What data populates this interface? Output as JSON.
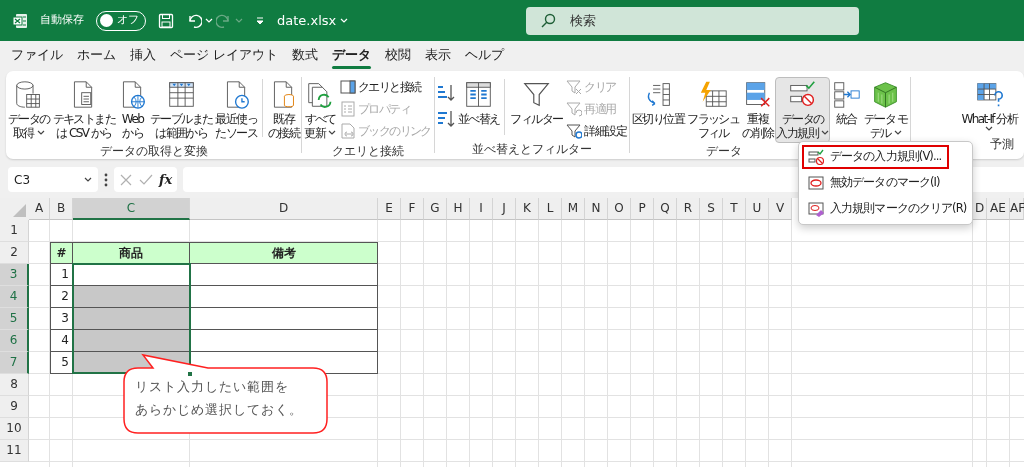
{
  "title_bar": {
    "autosave_label": "自動保存",
    "autosave": {
      "label": "オフ",
      "on": false
    },
    "filename": "date.xlsx",
    "search": {
      "placeholder": "検索"
    }
  },
  "tabs": [
    {
      "label": "ファイル",
      "selected": false
    },
    {
      "label": "ホーム",
      "selected": false
    },
    {
      "label": "挿入",
      "selected": false
    },
    {
      "label": "ページ レイアウト",
      "selected": false
    },
    {
      "label": "数式",
      "selected": false
    },
    {
      "label": "データ",
      "selected": true
    },
    {
      "label": "校閲",
      "selected": false
    },
    {
      "label": "表示",
      "selected": false
    },
    {
      "label": "ヘルプ",
      "selected": false
    }
  ],
  "ribbon_groups": [
    {
      "label": "データの取得と変換",
      "items": [
        {
          "kind": "large",
          "lines": [
            "データの",
            "取得"
          ],
          "dropdown": true,
          "pressed": false
        },
        {
          "kind": "large",
          "lines": [
            "テキストまた",
            "は CSV から"
          ],
          "dropdown": false,
          "pressed": false
        },
        {
          "kind": "large",
          "lines": [
            "Web",
            "から"
          ],
          "dropdown": false,
          "pressed": false
        },
        {
          "kind": "large",
          "lines": [
            "テーブルまた",
            "は範囲から"
          ],
          "dropdown": false,
          "pressed": false
        },
        {
          "kind": "large",
          "lines": [
            "最近使っ",
            "たソース"
          ],
          "dropdown": false,
          "pressed": false
        },
        {
          "kind": "separator"
        },
        {
          "kind": "large",
          "lines": [
            "既存",
            "の接続"
          ],
          "dropdown": false,
          "pressed": false
        }
      ]
    },
    {
      "label": "クエリと接続",
      "items": [
        {
          "kind": "large",
          "lines": [
            "すべて",
            "更新"
          ],
          "dropdown": true,
          "pressed": false
        },
        {
          "kind": "stack",
          "items": [
            {
              "label": "クエリと接続",
              "disabled": false
            },
            {
              "label": "プロパティ",
              "disabled": true
            },
            {
              "label": "ブックのリンク",
              "disabled": true
            }
          ]
        }
      ]
    },
    {
      "label": "並べ替えとフィルター",
      "items": [
        {
          "kind": "sort_pair"
        },
        {
          "kind": "large",
          "lines": [
            "並べ替え"
          ],
          "dropdown": false,
          "pressed": false
        },
        {
          "kind": "separator"
        },
        {
          "kind": "large",
          "lines": [
            "フィルター"
          ],
          "dropdown": false,
          "pressed": false
        },
        {
          "kind": "stack",
          "items": [
            {
              "label": "クリア",
              "disabled": true
            },
            {
              "label": "再適用",
              "disabled": true
            },
            {
              "label": "詳細設定",
              "disabled": false
            }
          ]
        }
      ]
    },
    {
      "label": "データ",
      "items": [
        {
          "kind": "large",
          "lines": [
            "区切り位置"
          ],
          "dropdown": false,
          "pressed": false
        },
        {
          "kind": "large",
          "lines": [
            "フラッシュ",
            "フィル"
          ],
          "dropdown": false,
          "pressed": false
        },
        {
          "kind": "large",
          "lines": [
            "重複",
            "の削除"
          ],
          "dropdown": false,
          "pressed": false
        },
        {
          "kind": "large",
          "lines": [
            "データの",
            "入力規則"
          ],
          "dropdown": true,
          "pressed": true
        },
        {
          "kind": "large",
          "lines": [
            "統合"
          ],
          "dropdown": false,
          "pressed": false
        },
        {
          "kind": "large",
          "lines": [
            "データ モ",
            "デル"
          ],
          "dropdown": true,
          "pressed": false
        }
      ]
    },
    {
      "label": "予測",
      "items": [
        {
          "kind": "large",
          "lines": [
            "What-If 分析"
          ],
          "dropdown": true,
          "pressed": false
        }
      ]
    }
  ],
  "formula_bar": {
    "name_box": "C3",
    "fx": "fx"
  },
  "sheet": {
    "columns": [
      {
        "label": "A",
        "selected": false
      },
      {
        "label": "B",
        "selected": false
      },
      {
        "label": "C",
        "selected": true
      },
      {
        "label": "D",
        "selected": false
      },
      {
        "label": "E",
        "selected": false
      },
      {
        "label": "F",
        "selected": false
      },
      {
        "label": "G",
        "selected": false
      },
      {
        "label": "H",
        "selected": false
      },
      {
        "label": "I",
        "selected": false
      },
      {
        "label": "J",
        "selected": false
      },
      {
        "label": "K",
        "selected": false
      },
      {
        "label": "L",
        "selected": false
      },
      {
        "label": "M",
        "selected": false
      },
      {
        "label": "N",
        "selected": false
      },
      {
        "label": "O",
        "selected": false
      },
      {
        "label": "P",
        "selected": false
      },
      {
        "label": "Q",
        "selected": false
      },
      {
        "label": "R",
        "selected": false
      },
      {
        "label": "S",
        "selected": false
      },
      {
        "label": "T",
        "selected": false
      },
      {
        "label": "U",
        "selected": false
      },
      {
        "label": "V",
        "selected": false
      },
      {
        "label": "D",
        "selected": false
      },
      {
        "label": "AE",
        "selected": false
      },
      {
        "label": "AF",
        "selected": false
      }
    ],
    "rows": [
      {
        "label": "1",
        "selected": false
      },
      {
        "label": "2",
        "selected": false
      },
      {
        "label": "3",
        "selected": true
      },
      {
        "label": "4",
        "selected": true
      },
      {
        "label": "5",
        "selected": true
      },
      {
        "label": "6",
        "selected": true
      },
      {
        "label": "7",
        "selected": true
      },
      {
        "label": "8",
        "selected": false
      },
      {
        "label": "9",
        "selected": false
      },
      {
        "label": "10",
        "selected": false
      },
      {
        "label": "11",
        "selected": false
      }
    ],
    "table": {
      "header": [
        "#",
        "商品",
        "備考"
      ],
      "rows": [
        {
          "number": "1",
          "selected": false
        },
        {
          "number": "2",
          "selected": true
        },
        {
          "number": "3",
          "selected": true
        },
        {
          "number": "4",
          "selected": true
        },
        {
          "number": "5",
          "selected": true
        }
      ]
    }
  },
  "context_menu": {
    "items": [
      {
        "label": "データの入力規則(V)...",
        "highlighted": true
      },
      {
        "label": "無効データのマーク(I)",
        "highlighted": false
      },
      {
        "label": "入力規則マークのクリア(R)",
        "highlighted": false
      }
    ]
  },
  "callout": {
    "lines": [
      "リスト入力したい範囲を",
      "あらかじめ選択しておく。"
    ]
  }
}
